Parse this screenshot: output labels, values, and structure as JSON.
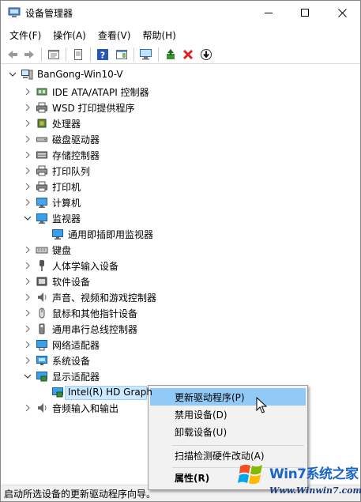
{
  "window": {
    "title": "设备管理器"
  },
  "menubar": {
    "items": [
      "文件(F)",
      "操作(A)",
      "查看(V)",
      "帮助(H)"
    ]
  },
  "toolbar": {
    "icons": [
      "back-arrow-icon",
      "forward-arrow-icon",
      "properties-sheet-icon",
      "print-icon",
      "help-icon",
      "action-pane-icon",
      "monitor-scan-icon",
      "update-driver-icon",
      "uninstall-x-icon",
      "install-legacy-icon"
    ]
  },
  "tree": {
    "root": "BanGong-Win10-V",
    "categories": [
      {
        "label": "IDE ATA/ATAPI 控制器",
        "icon": "ide-controller-icon",
        "expanded": false
      },
      {
        "label": "WSD 打印提供程序",
        "icon": "printer-icon",
        "expanded": false
      },
      {
        "label": "处理器",
        "icon": "processor-icon",
        "expanded": false
      },
      {
        "label": "磁盘驱动器",
        "icon": "disk-drive-icon",
        "expanded": false
      },
      {
        "label": "存储控制器",
        "icon": "storage-controller-icon",
        "expanded": false
      },
      {
        "label": "打印队列",
        "icon": "print-queue-icon",
        "expanded": false
      },
      {
        "label": "打印机",
        "icon": "printer-icon",
        "expanded": false
      },
      {
        "label": "计算机",
        "icon": "computer-icon",
        "expanded": false
      },
      {
        "label": "监视器",
        "icon": "monitor-icon",
        "expanded": true
      },
      {
        "label": "通用即插即用监视器",
        "icon": "monitor-icon",
        "child": true
      },
      {
        "label": "键盘",
        "icon": "keyboard-icon",
        "expanded": false
      },
      {
        "label": "人体学输入设备",
        "icon": "hid-icon",
        "expanded": false
      },
      {
        "label": "软件设备",
        "icon": "software-device-icon",
        "expanded": false
      },
      {
        "label": "声音、视频和游戏控制器",
        "icon": "speaker-icon",
        "expanded": false
      },
      {
        "label": "鼠标和其他指针设备",
        "icon": "mouse-icon",
        "expanded": false
      },
      {
        "label": "通用串行总线控制器",
        "icon": "usb-icon",
        "expanded": false
      },
      {
        "label": "网络适配器",
        "icon": "network-adapter-icon",
        "expanded": false
      },
      {
        "label": "系统设备",
        "icon": "system-device-icon",
        "expanded": false
      },
      {
        "label": "显示适配器",
        "icon": "display-adapter-icon",
        "expanded": true
      },
      {
        "label": "Intel(R) HD Graph",
        "icon": "display-adapter-icon",
        "child": true,
        "selected": true
      },
      {
        "label": "音频输入和输出",
        "icon": "speaker-icon",
        "expanded": false
      }
    ]
  },
  "context_menu": {
    "items": [
      {
        "label": "更新驱动程序(P)",
        "highlighted": true
      },
      {
        "label": "禁用设备(D)"
      },
      {
        "label": "卸载设备(U)"
      },
      {
        "label": "扫描检测硬件改动(A)"
      },
      {
        "label": "属性(R)",
        "bold": true
      }
    ]
  },
  "statusbar": {
    "text": "启动所选设备的更新驱动程序向导。"
  },
  "watermark": {
    "brand": "Win7系统之家",
    "url": "Www.Winwin7.com"
  },
  "colors": {
    "selection_bg": "#cce8ff",
    "menu_hot": "#91c9f7",
    "watermark_blue": "#1b65c6"
  }
}
